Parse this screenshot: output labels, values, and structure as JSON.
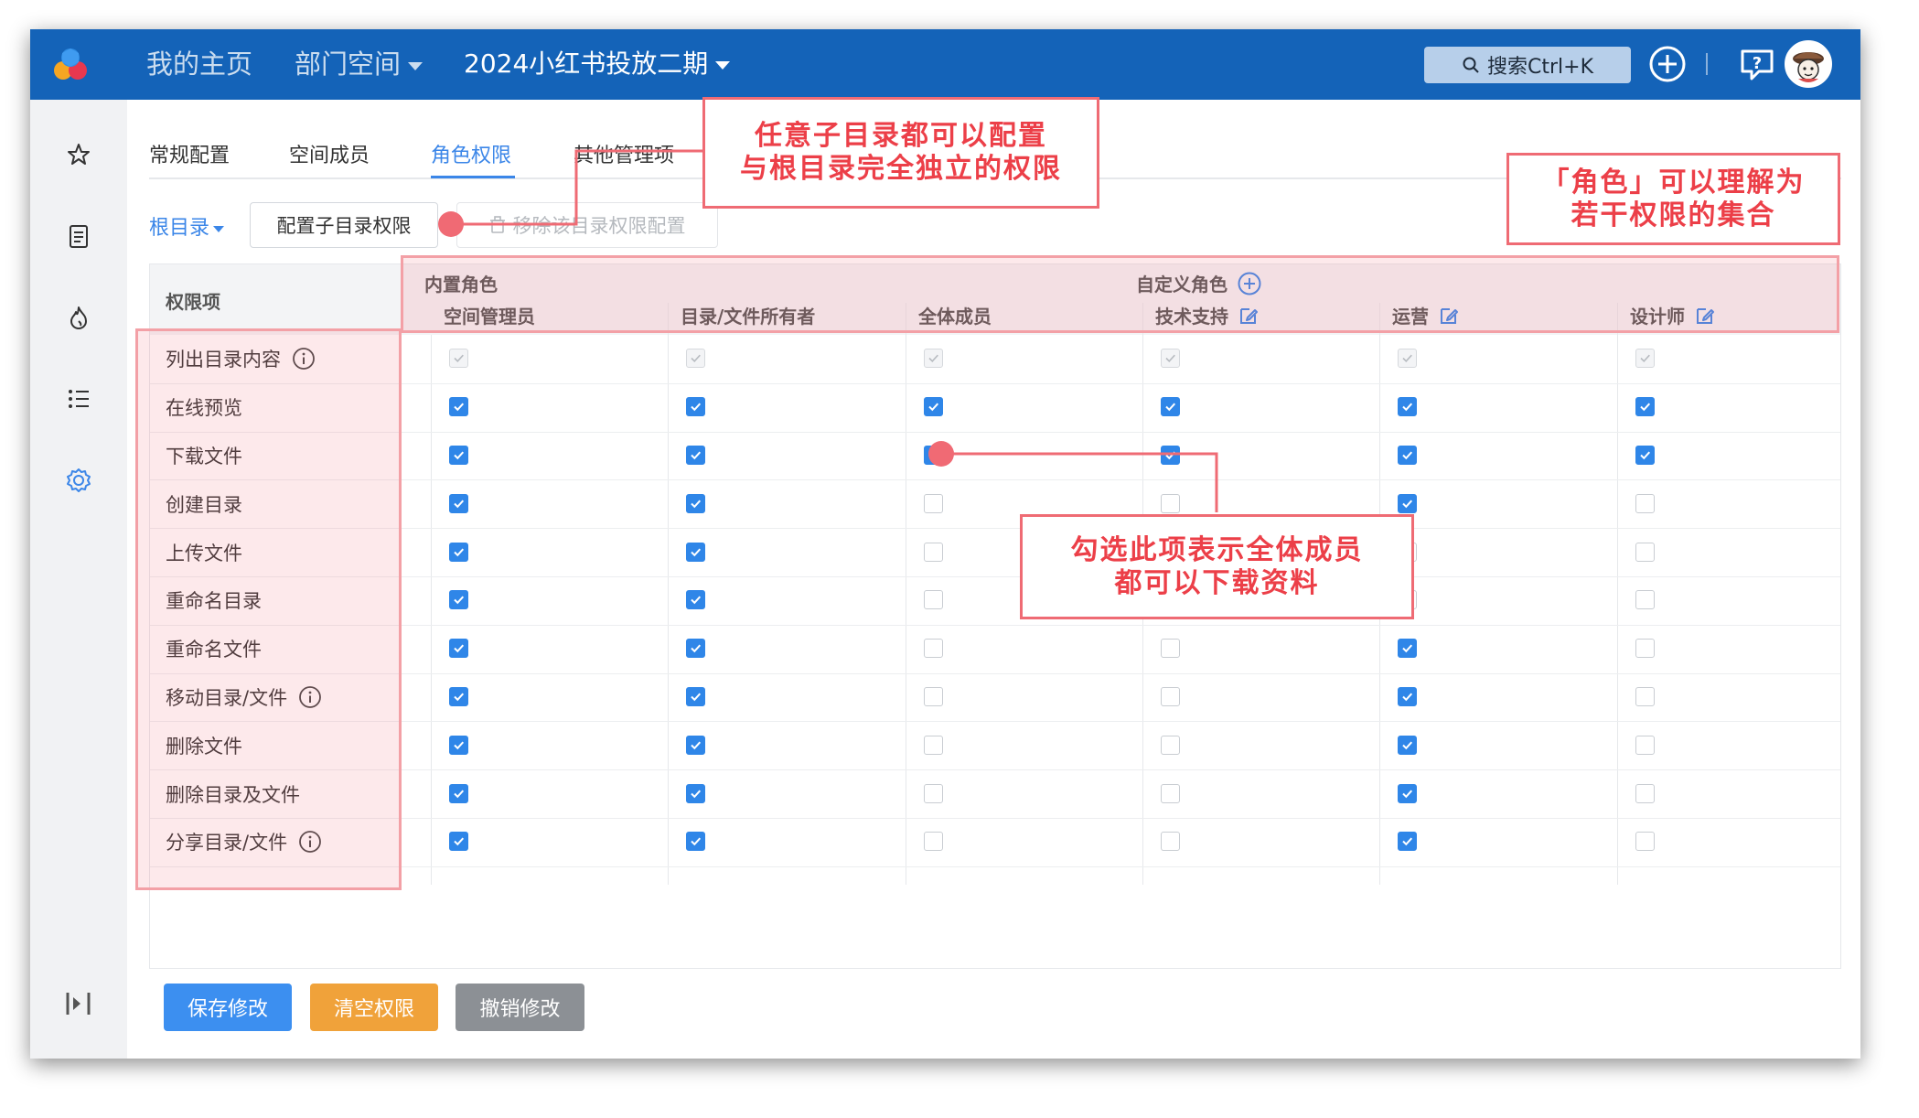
{
  "header": {
    "nav_home": "我的主页",
    "nav_dept": "部门空间",
    "project_title": "2024小红书投放二期",
    "search_label": "搜索Ctrl+K",
    "bar_color": "#1463b8",
    "icons": [
      "logo-icon",
      "plus-circle-icon",
      "help-icon",
      "avatar"
    ]
  },
  "sidebar": {
    "icons": [
      "star-icon",
      "document-icon",
      "fire-icon",
      "list-icon",
      "settings-icon",
      "collapse-icon"
    ]
  },
  "tabs": [
    {
      "label": "常规配置"
    },
    {
      "label": "空间成员"
    },
    {
      "label": "角色权限"
    },
    {
      "label": "其他管理项"
    }
  ],
  "active_tab": "角色权限",
  "toolbar": {
    "root_dir": "根目录",
    "config_button": "配置子目录权限",
    "remove_button": "移除该目录权限配置"
  },
  "table": {
    "permission_header": "权限项",
    "builtin_group": "内置角色",
    "custom_group": "自定义角色",
    "columns": [
      "空间管理员",
      "目录/文件所有者",
      "全体成员",
      "技术支持",
      "运营",
      "设计师"
    ],
    "rows": [
      {
        "label": "列出目录内容",
        "info": true,
        "values": [
          "disabled",
          "disabled",
          "disabled",
          "disabled",
          "disabled",
          "disabled"
        ]
      },
      {
        "label": "在线预览",
        "info": false,
        "values": [
          "on",
          "on",
          "on",
          "on",
          "on",
          "on"
        ]
      },
      {
        "label": "下载文件",
        "info": false,
        "values": [
          "on",
          "on",
          "on",
          "on",
          "on",
          "on"
        ]
      },
      {
        "label": "创建目录",
        "info": false,
        "values": [
          "on",
          "on",
          "off",
          "off",
          "on",
          "off"
        ]
      },
      {
        "label": "上传文件",
        "info": false,
        "values": [
          "on",
          "on",
          "off",
          "off",
          "off",
          "off"
        ]
      },
      {
        "label": "重命名目录",
        "info": false,
        "values": [
          "on",
          "on",
          "off",
          "off",
          "off",
          "off"
        ]
      },
      {
        "label": "重命名文件",
        "info": false,
        "values": [
          "on",
          "on",
          "off",
          "off",
          "on",
          "off"
        ]
      },
      {
        "label": "移动目录/文件",
        "info": true,
        "values": [
          "on",
          "on",
          "off",
          "off",
          "on",
          "off"
        ]
      },
      {
        "label": "删除文件",
        "info": false,
        "values": [
          "on",
          "on",
          "off",
          "off",
          "on",
          "off"
        ]
      },
      {
        "label": "删除目录及文件",
        "info": false,
        "values": [
          "on",
          "on",
          "off",
          "off",
          "on",
          "off"
        ]
      },
      {
        "label": "分享目录/文件",
        "info": true,
        "values": [
          "on",
          "on",
          "off",
          "off",
          "on",
          "off"
        ]
      }
    ]
  },
  "footer": {
    "save": "保存修改",
    "clear": "清空权限",
    "undo": "撤销修改",
    "save_color": "#3c8ff0",
    "clear_color": "#f0a23a",
    "undo_color": "#8c9095"
  },
  "annotations": {
    "subdir_line1": "任意子目录都可以配置",
    "subdir_line2": "与根目录完全独立的权限",
    "role_line1": "「角色」可以理解为",
    "role_line2": "若干权限的集合",
    "download_line1": "勾选此项表示全体成员",
    "download_line2": "都可以下载资料",
    "color": "#ec3f48"
  }
}
